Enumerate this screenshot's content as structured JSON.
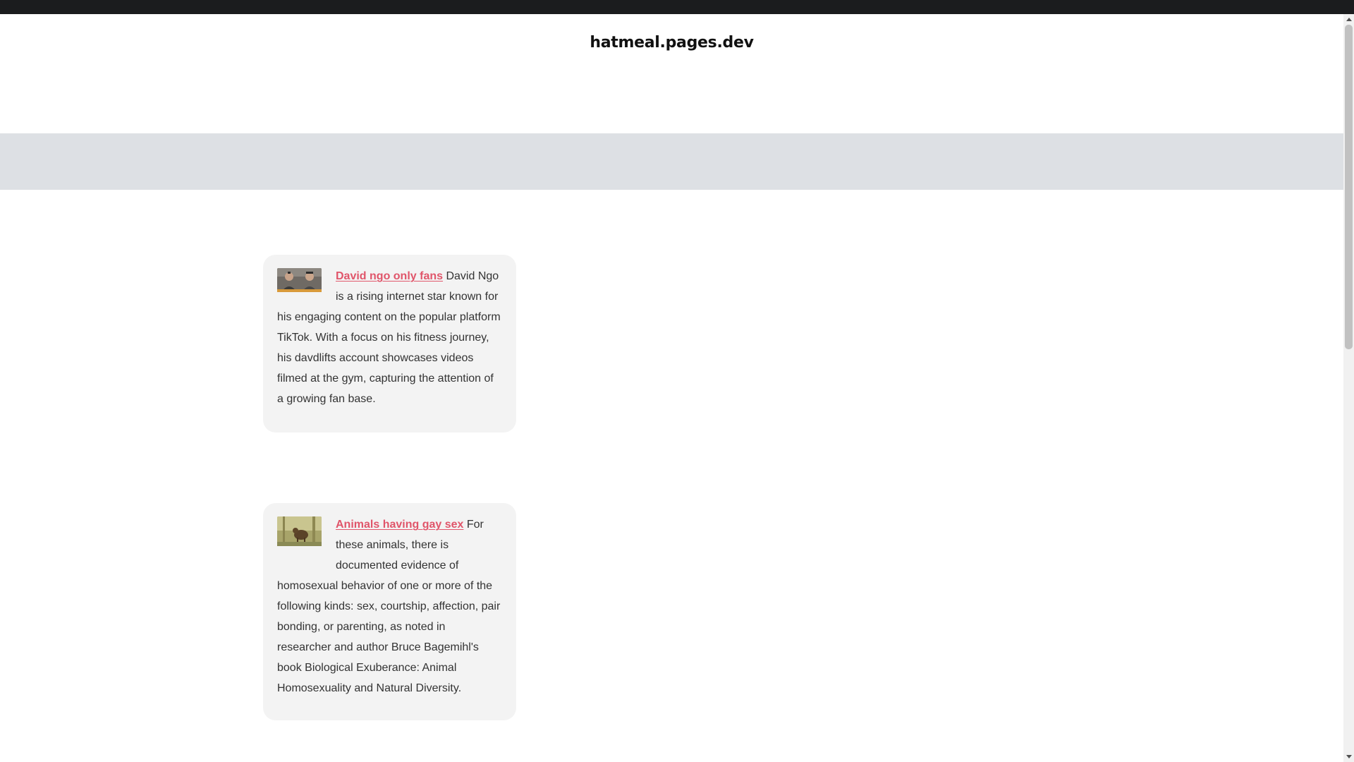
{
  "site": {
    "title": "hatmeal.pages.dev"
  },
  "posts": [
    {
      "title": "David ngo only fans",
      "excerpt": " David Ngo is a rising internet star known for his engaging content on the popular platform TikTok. With a focus on his fitness journey, his davdlifts account showcases videos filmed at the gym, capturing the attention of a growing fan base."
    },
    {
      "title": "Animals having gay sex",
      "excerpt": " For these animals, there is documented evidence of homosexual behavior of one or more of the following kinds: sex, courtship, affection, pair bonding, or parenting, as noted in researcher and author Bruce Bagemihl's book Biological Exuberance: Animal Homosexuality and Natural Diversity."
    }
  ],
  "colors": {
    "topbar": "#1b1c1e",
    "band": "#dde0e4",
    "card_background": "#f3f3f3",
    "link": "#e0556a"
  },
  "icons": {
    "scroll_up": "triangle-up-icon",
    "scroll_down": "triangle-down-icon"
  }
}
